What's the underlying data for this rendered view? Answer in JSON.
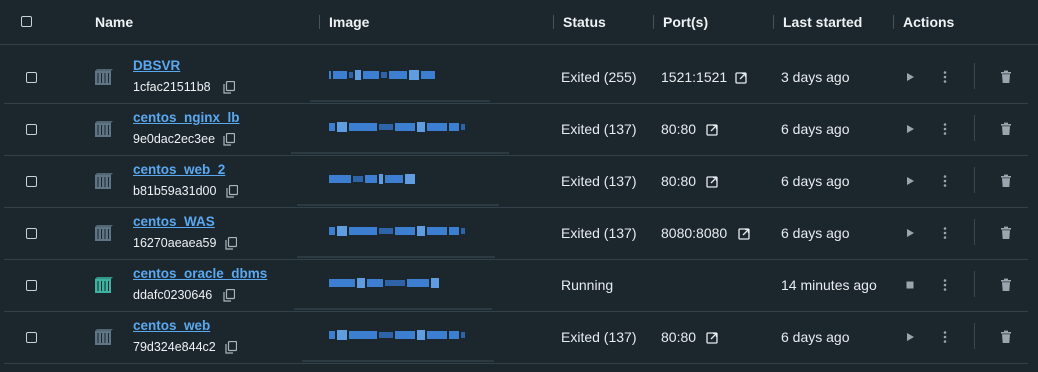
{
  "header": {
    "name": "Name",
    "image": "Image",
    "status": "Status",
    "ports": "Port(s)",
    "last_started": "Last started",
    "actions": "Actions"
  },
  "colors": {
    "background": "#1c262d",
    "link": "#5aa9f0",
    "icon_stopped": "#5f7585",
    "icon_running": "#3bb3a0"
  },
  "rows": [
    {
      "name": "DBSVR",
      "id": "1cfac21511b8",
      "status": "Exited (255)",
      "port": "1521:1521",
      "last_started": "3 days ago",
      "state": "stopped"
    },
    {
      "name": "centos_nginx_lb",
      "id": "9e0dac2ec3ee",
      "status": "Exited (137)",
      "port": "80:80",
      "last_started": "6 days ago",
      "state": "stopped"
    },
    {
      "name": "centos_web_2",
      "id": "b81b59a31d00",
      "status": "Exited (137)",
      "port": "80:80",
      "last_started": "6 days ago",
      "state": "stopped"
    },
    {
      "name": "centos_WAS",
      "id": "16270aeaea59",
      "status": "Exited (137)",
      "port": "8080:8080",
      "last_started": "6 days ago",
      "state": "stopped"
    },
    {
      "name": "centos_oracle_dbms",
      "id": "ddafc0230646",
      "status": "Running",
      "port": "",
      "last_started": "14 minutes ago",
      "state": "running"
    },
    {
      "name": "centos_web",
      "id": "79d324e844c2",
      "status": "Exited (137)",
      "port": "80:80",
      "last_started": "6 days ago",
      "state": "stopped"
    }
  ]
}
